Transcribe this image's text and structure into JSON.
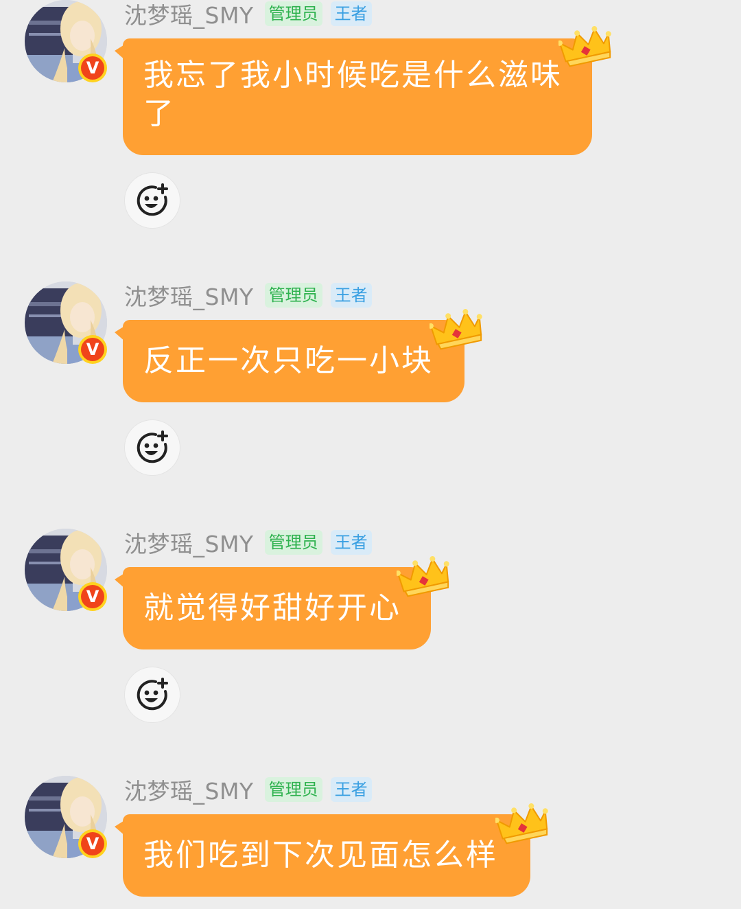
{
  "messages": [
    {
      "sender": "沈梦瑶_SMY",
      "badges": {
        "admin": "管理员",
        "rank": "王者"
      },
      "verified_mark": "V",
      "text": "我忘了我小时候吃是什么滋味了",
      "icons": {
        "avatar": "user-avatar",
        "crown": "crown-icon",
        "reaction": "add-reaction-icon"
      }
    },
    {
      "sender": "沈梦瑶_SMY",
      "badges": {
        "admin": "管理员",
        "rank": "王者"
      },
      "verified_mark": "V",
      "text": "反正一次只吃一小块",
      "icons": {
        "avatar": "user-avatar",
        "crown": "crown-icon",
        "reaction": "add-reaction-icon"
      }
    },
    {
      "sender": "沈梦瑶_SMY",
      "badges": {
        "admin": "管理员",
        "rank": "王者"
      },
      "verified_mark": "V",
      "text": "就觉得好甜好开心",
      "icons": {
        "avatar": "user-avatar",
        "crown": "crown-icon",
        "reaction": "add-reaction-icon"
      }
    },
    {
      "sender": "沈梦瑶_SMY",
      "badges": {
        "admin": "管理员",
        "rank": "王者"
      },
      "verified_mark": "V",
      "text": "我们吃到下次见面怎么样",
      "icons": {
        "avatar": "user-avatar",
        "crown": "crown-icon",
        "reaction": "add-reaction-icon"
      }
    }
  ],
  "colors": {
    "background": "#ededed",
    "bubble": "#ffa033",
    "bubble_text": "#ffffff",
    "sender_name": "#8f8f8f",
    "admin_tag_bg": "#d9f2de",
    "admin_tag_text": "#2fb24f",
    "rank_tag_bg": "#d9ebf8",
    "rank_tag_text": "#3aa0e2",
    "verified_badge": "#f0441a",
    "crown_gold": "#ffc21a"
  }
}
